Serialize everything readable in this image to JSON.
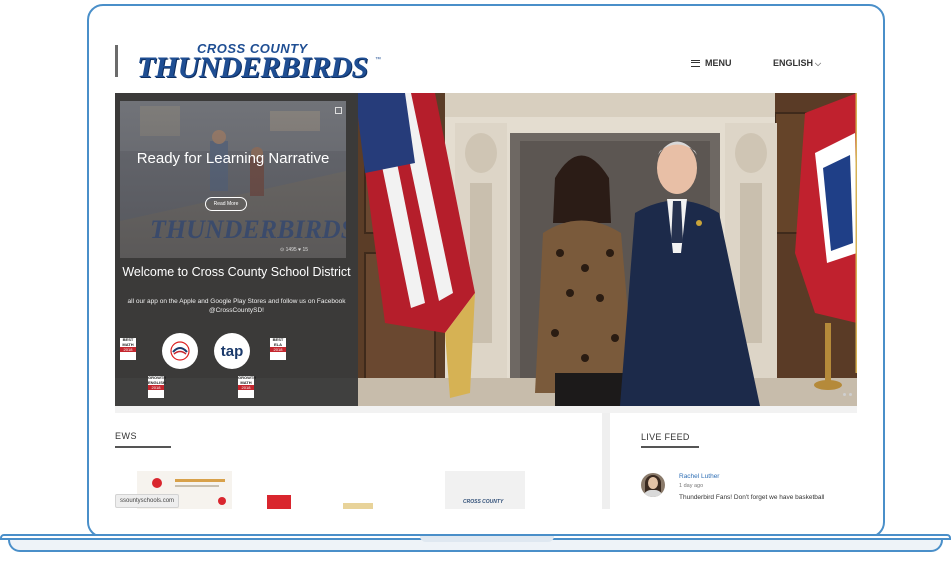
{
  "site": {
    "logo_small": "CROSS COUNTY",
    "logo_big": "THUNDERBIRDS",
    "logo_tm": "™"
  },
  "nav": {
    "menu_label": "MENU",
    "language_label": "ENGLISH"
  },
  "hero": {
    "video_card": {
      "title": "Ready for Learning Narrative",
      "read_more": "Read More",
      "watermark": "THUNDERBIRDS",
      "stats": "⊙ 1495   ♥ 15"
    },
    "welcome_title": "Welcome to Cross County School District",
    "welcome_text": "all our app on the Apple and Google Play Stores and follow us on Facebook @CrossCountySD!",
    "badges": [
      {
        "top": "BEST MATH",
        "band": "2018"
      },
      {
        "top": "BEST ELA",
        "band": "2018"
      },
      {
        "top": "GROWTH ENGLISH",
        "band": "2018"
      },
      {
        "top": "GROWTH MATH",
        "band": "2018"
      }
    ],
    "tap_label": "tap"
  },
  "news": {
    "heading": "EWS",
    "thumb_text": "CROSS COUNTY",
    "url": "ssountyschools.com"
  },
  "live_feed": {
    "heading": "LIVE FEED",
    "post": {
      "author": "Rachel Luther",
      "time": "1 day ago",
      "text": "Thunderbird Fans! Don't forget we have basketball"
    }
  },
  "colors": {
    "frame": "#4a8fc9",
    "brand_blue": "#1f4e93",
    "link_blue": "#2f6fb5",
    "badge_red": "#c4262e"
  }
}
